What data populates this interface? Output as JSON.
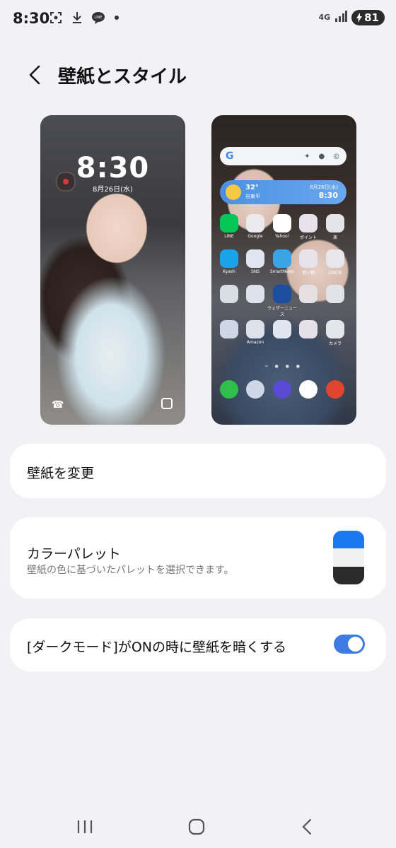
{
  "status_bar": {
    "time": "8:30",
    "network": "4G",
    "battery": "81"
  },
  "header": {
    "title": "壁紙とスタイル"
  },
  "lock_preview": {
    "time": "8:30",
    "date": "8月26日(水)"
  },
  "home_preview": {
    "search_logo": "G",
    "weather": {
      "temp": "32°",
      "place": "谷東平",
      "date": "8月26日(水)",
      "time": "8:30"
    },
    "apps": [
      {
        "label": "LINE",
        "color": "#06c755"
      },
      {
        "label": "Google",
        "color": "#e9e9ee"
      },
      {
        "label": "Yahoo!",
        "color": "#ffffff"
      },
      {
        "label": "ポイント",
        "color": "#e7e2ea"
      },
      {
        "label": "楽",
        "color": "#e3e3e8"
      },
      {
        "label": "Kyash",
        "color": "#1aa3e8"
      },
      {
        "label": "SNS",
        "color": "#dfe6ef"
      },
      {
        "label": "SmartNews",
        "color": "#3aa4e6"
      },
      {
        "label": "買い物",
        "color": "#e6e3ea"
      },
      {
        "label": "LINE系",
        "color": "#e6e6ec"
      },
      {
        "label": "",
        "color": "#d9dde6"
      },
      {
        "label": "",
        "color": "#dde3ea"
      },
      {
        "label": "ウェザーニュース",
        "color": "#1d4d9e"
      },
      {
        "label": "",
        "color": "#e6e0e3"
      },
      {
        "label": "",
        "color": "#e1e3e8"
      },
      {
        "label": "",
        "color": "#cdd7e6"
      },
      {
        "label": "Amazon",
        "color": "#dde2ea"
      },
      {
        "label": "",
        "color": "#e0e6ef"
      },
      {
        "label": "",
        "color": "#e6e0ea"
      },
      {
        "label": "カメラ",
        "color": "#e3e6ec"
      }
    ],
    "dock": [
      {
        "label": "phone",
        "color": "#2fbf4a"
      },
      {
        "label": "folder",
        "color": "#cfd7e6"
      },
      {
        "label": "internet",
        "color": "#5a4bd6"
      },
      {
        "label": "play",
        "color": "#ffffff"
      },
      {
        "label": "shield",
        "color": "#e2452f"
      }
    ]
  },
  "settings": {
    "change_wallpaper": "壁紙を変更",
    "color_palette": {
      "title": "カラーパレット",
      "subtitle": "壁紙の色に基づいたパレットを選択できます。",
      "colors": [
        "#1978f2",
        "#f1f1f1",
        "#2b2b2b"
      ]
    },
    "dark_mode_dim": {
      "label": "[ダークモード]がONの時に壁紙を暗くする",
      "enabled": true
    }
  },
  "colors": {
    "background": "#f2f2f4",
    "card": "#ffffff",
    "accent": "#3e7be3"
  }
}
